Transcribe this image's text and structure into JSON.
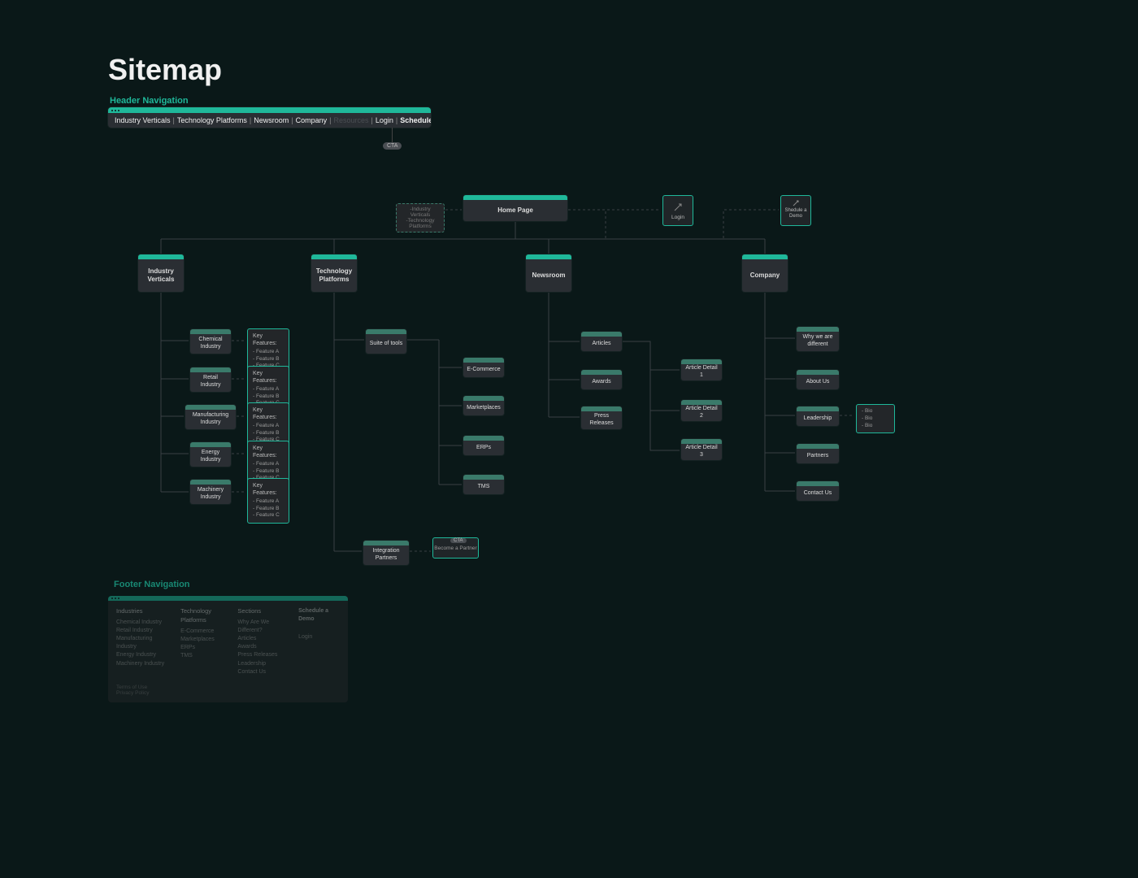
{
  "title": "Sitemap",
  "headerNavLabel": "Header Navigation",
  "footerNavLabel": "Footer Navigation",
  "ctaBadge": "CTA",
  "headerNav": {
    "items": [
      "Industry Verticals",
      "Technology Platforms",
      "Newsroom",
      "Company"
    ],
    "mutedItem": "Resources",
    "login": "Login",
    "cta": "Schedule a Demo"
  },
  "dropdownHint": {
    "line1": "-Industry Verticals",
    "line2": "-Technology Platforms"
  },
  "homePage": "Home Page",
  "login": "Login",
  "scheduleDemo": {
    "line1": "Shedule a",
    "line2": "Demo"
  },
  "sections": {
    "industryVerticals": "Industry Verticals",
    "technologyPlatforms": "Technology Platforms",
    "newsroom": "Newsroom",
    "company": "Company"
  },
  "industries": [
    "Chemical Industry",
    "Retail Industry",
    "Manufacturing Industry",
    "Energy Industry",
    "Machinery Industry"
  ],
  "featureTitle": "Key Features:",
  "featureItems": [
    "- Feature A",
    "- Feature B",
    "- Feature C"
  ],
  "suiteOfTools": "Suite of tools",
  "platforms": [
    "E-Commerce",
    "Marketplaces",
    "ERPs",
    "TMS"
  ],
  "integrationPartners": "Integration Partners",
  "becomePartner": "Become a Partner",
  "partnerBadge": "CTA",
  "newsroomItems": [
    "Articles",
    "Awards",
    "Press Releases"
  ],
  "articleDetails": [
    "Article Detail 1",
    "Article Detail 2",
    "Article Detail 3"
  ],
  "companyItems": [
    "Why we are different",
    "About Us",
    "Leadership",
    "Partners",
    "Contact Us"
  ],
  "leadershipBios": [
    "- Bio",
    "- Bio",
    "- Bio"
  ],
  "footer": {
    "col1": {
      "h": "Industries",
      "items": [
        "Chemical Industry",
        "Retail Industry",
        "Manufacturing Industry",
        "Energy Industry",
        "Machinery Industry"
      ]
    },
    "col2": {
      "h": "Technology Platforms",
      "items": [
        "E-Commerce",
        "Marketplaces",
        "ERPs",
        "TMS"
      ]
    },
    "col3": {
      "h": "Sections",
      "items": [
        "Why Are We Different?",
        "Articles",
        "Awards",
        "Press Releases",
        "Leadership",
        "Contact Us"
      ]
    },
    "col4": {
      "cta": "Schedule a Demo",
      "login": "Login"
    },
    "meta": [
      "Terms of Use",
      "Privacy Policy"
    ]
  }
}
